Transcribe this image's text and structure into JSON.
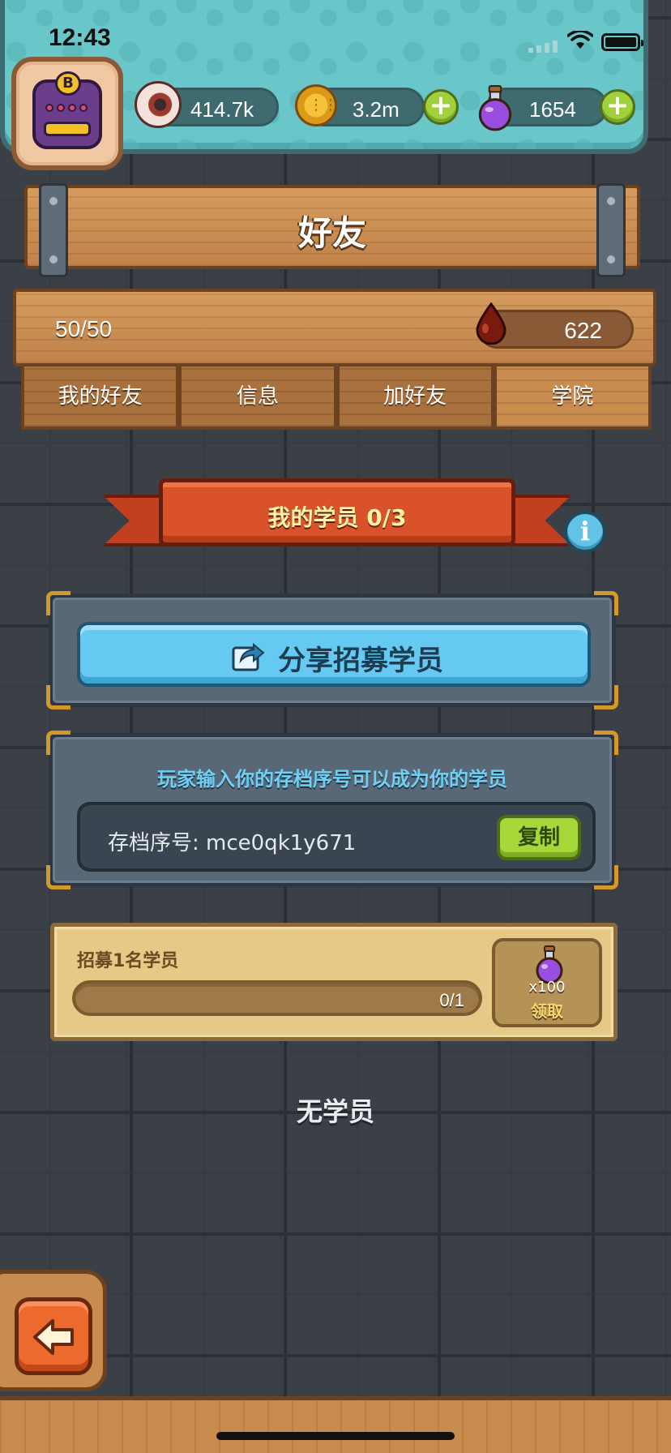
{
  "status_bar": {
    "time": "12:43"
  },
  "currencies": {
    "eyes": "414.7k",
    "coins": "3.2m",
    "potions": "1654"
  },
  "header": {
    "title": "好友"
  },
  "friends": {
    "count": "50/50",
    "blood": "622"
  },
  "tabs": [
    {
      "label": "我的好友"
    },
    {
      "label": "信息"
    },
    {
      "label": "加好友"
    },
    {
      "label": "学院",
      "active": true
    }
  ],
  "academy": {
    "banner": "我的学员 0/3",
    "share_button": "分享招募学员",
    "code_hint": "玩家输入你的存档序号可以成为你的学员",
    "code_text": "存档序号: mce0qk1y671",
    "copy_button": "复制",
    "task": {
      "title": "招募1名学员",
      "progress_text": "0/1",
      "progress_fraction": 0,
      "reward_qty": "x100",
      "claim_label": "领取"
    },
    "empty_text": "无学员"
  },
  "colors": {
    "teal_panel": "#6ac7c9",
    "wood": "#c98c4f",
    "ribbon": "#d9522a",
    "share_button": "#66c9f2",
    "copy_button": "#a6d83a",
    "back_button": "#ec6a2e"
  },
  "icons": [
    "eye-icon",
    "coin-icon",
    "potion-icon",
    "plus-icon",
    "blood-drop-icon",
    "info-icon",
    "share-icon",
    "back-arrow-icon",
    "avatar-icon"
  ]
}
